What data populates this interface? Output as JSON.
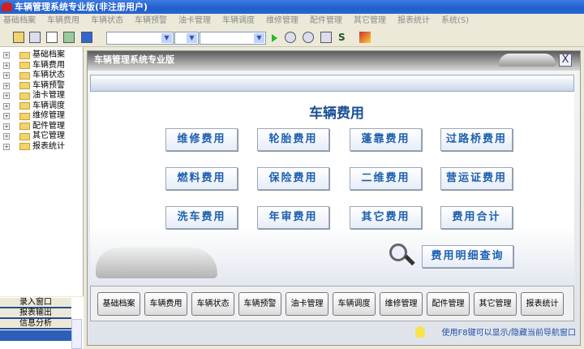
{
  "app": {
    "title": "车辆管理系统专业版(非注册用户)"
  },
  "menu": [
    "基础档案",
    "车辆费用",
    "车辆状态",
    "车辆预警",
    "油卡管理",
    "车辆调度",
    "维修管理",
    "配件管理",
    "其它管理",
    "报表统计",
    "系统(S)"
  ],
  "tree": [
    "基础档案",
    "车辆费用",
    "车辆状态",
    "车辆预警",
    "油卡管理",
    "车辆调度",
    "维修管理",
    "配件管理",
    "其它管理",
    "报表统计"
  ],
  "nav": [
    "录入窗口",
    "报表输出",
    "信息分析"
  ],
  "window": {
    "title": "车辆管理系统专业版",
    "close": "X",
    "heading": "车辆费用"
  },
  "functions": [
    "维修费用",
    "轮胎费用",
    "蓬靠费用",
    "过路桥费用",
    "燃料费用",
    "保险费用",
    "二维费用",
    "营运证费用",
    "洗车费用",
    "年审费用",
    "其它费用",
    "费用合计"
  ],
  "detail_button": "费用明细查询",
  "bottom_buttons": [
    "基础档案",
    "车辆费用",
    "车辆状态",
    "车辆预警",
    "油卡管理",
    "车辆调度",
    "维修管理",
    "配件管理",
    "其它管理",
    "报表统计"
  ],
  "hint": "使用F8键可以显示/隐藏当前导航窗口"
}
